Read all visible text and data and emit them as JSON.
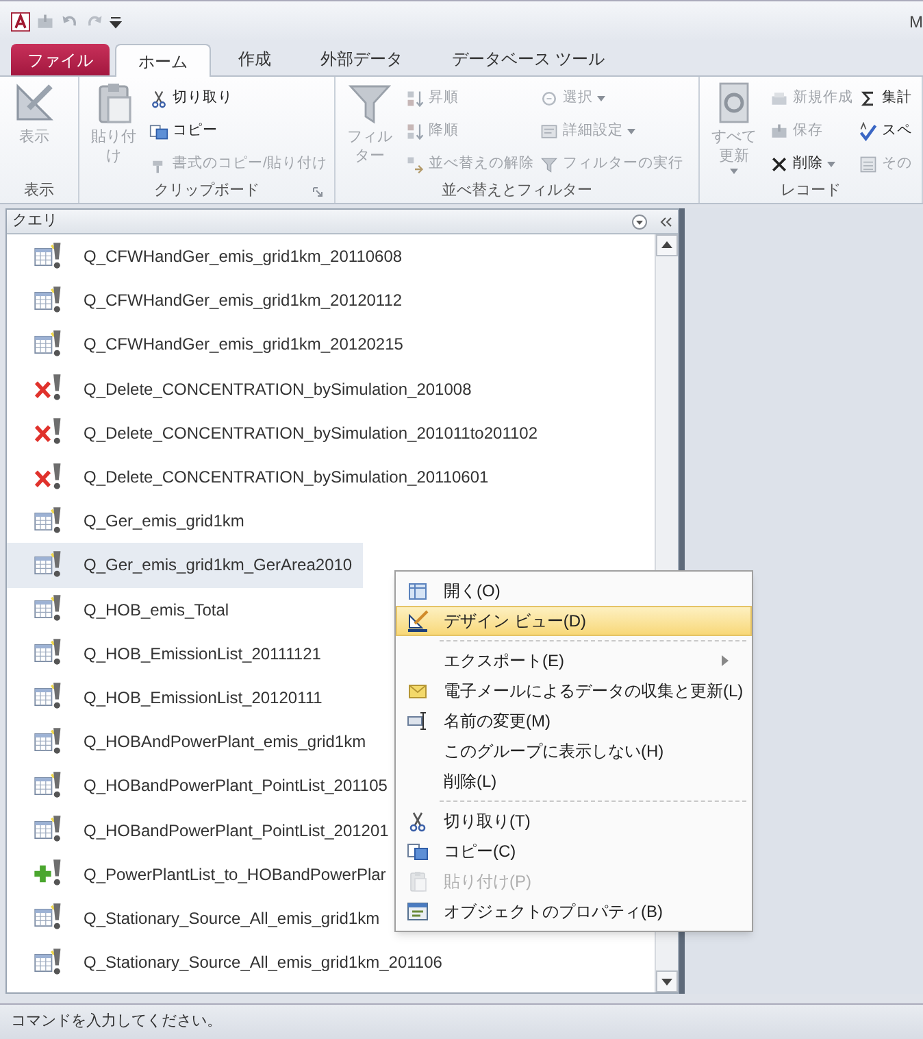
{
  "window": {
    "title": "M"
  },
  "tabs": [
    {
      "label": "ファイル",
      "kind": "file",
      "selected": false
    },
    {
      "label": "ホーム",
      "kind": "tab",
      "selected": true
    },
    {
      "label": "作成",
      "kind": "tab",
      "selected": false
    },
    {
      "label": "外部データ",
      "kind": "tab",
      "selected": false
    },
    {
      "label": "データベース ツール",
      "kind": "tab",
      "selected": false
    }
  ],
  "ribbon": {
    "groups": [
      {
        "label": "表示",
        "big": {
          "label": "表示",
          "disabled": true,
          "dropdown": false
        }
      },
      {
        "label": "クリップボード",
        "launcher": true,
        "big": {
          "label": "貼り付け",
          "disabled": true,
          "dropdown": false
        },
        "columns": [
          [
            {
              "label": "切り取り",
              "disabled": false,
              "dropdown": false
            },
            {
              "label": "コピー",
              "disabled": false,
              "dropdown": false
            },
            {
              "label": "書式のコピー/貼り付け",
              "disabled": true,
              "dropdown": false
            }
          ]
        ]
      },
      {
        "label": "並べ替えとフィルター",
        "big": {
          "label": "フィルター",
          "disabled": true,
          "dropdown": false
        },
        "columns": [
          [
            {
              "label": "昇順",
              "disabled": true,
              "dropdown": false
            },
            {
              "label": "降順",
              "disabled": true,
              "dropdown": false
            },
            {
              "label": "並べ替えの解除",
              "disabled": true,
              "dropdown": false
            }
          ],
          [
            {
              "label": "選択",
              "disabled": true,
              "dropdown": true
            },
            {
              "label": "詳細設定",
              "disabled": true,
              "dropdown": true
            },
            {
              "label": "フィルターの実行",
              "disabled": true,
              "dropdown": false
            }
          ]
        ]
      },
      {
        "label": "レコード",
        "big": {
          "label": "すべて更新",
          "disabled": true,
          "dropdown": true
        },
        "columns": [
          [
            {
              "label": "新規作成",
              "disabled": true,
              "dropdown": false
            },
            {
              "label": "保存",
              "disabled": true,
              "dropdown": false
            },
            {
              "label": "削除",
              "disabled": false,
              "dropdown": true
            }
          ],
          [
            {
              "label": "集計",
              "disabled": false,
              "dropdown": false
            },
            {
              "label": "スペ",
              "disabled": false,
              "dropdown": false
            },
            {
              "label": "その",
              "disabled": true,
              "dropdown": false
            }
          ]
        ]
      }
    ]
  },
  "navigation_pane": {
    "title": "クエリ",
    "items": [
      {
        "label": "Q_CFWHandGer_emis_grid1km_20110608",
        "kind": "select",
        "selected": false
      },
      {
        "label": "Q_CFWHandGer_emis_grid1km_20120112",
        "kind": "select",
        "selected": false
      },
      {
        "label": "Q_CFWHandGer_emis_grid1km_20120215",
        "kind": "select",
        "selected": false
      },
      {
        "label": "Q_Delete_CONCENTRATION_bySimulation_201008",
        "kind": "delete",
        "selected": false
      },
      {
        "label": "Q_Delete_CONCENTRATION_bySimulation_201011to201102",
        "kind": "delete",
        "selected": false
      },
      {
        "label": "Q_Delete_CONCENTRATION_bySimulation_20110601",
        "kind": "delete",
        "selected": false
      },
      {
        "label": "Q_Ger_emis_grid1km",
        "kind": "select",
        "selected": false
      },
      {
        "label": "Q_Ger_emis_grid1km_GerArea2010",
        "kind": "select",
        "selected": true
      },
      {
        "label": "Q_HOB_emis_Total",
        "kind": "select",
        "selected": false
      },
      {
        "label": "Q_HOB_EmissionList_20111121",
        "kind": "select",
        "selected": false
      },
      {
        "label": "Q_HOB_EmissionList_20120111",
        "kind": "select",
        "selected": false
      },
      {
        "label": "Q_HOBAndPowerPlant_emis_grid1km",
        "kind": "select",
        "selected": false
      },
      {
        "label": "Q_HOBandPowerPlant_PointList_201105",
        "kind": "select",
        "selected": false
      },
      {
        "label": "Q_HOBandPowerPlant_PointList_201201",
        "kind": "select",
        "selected": false
      },
      {
        "label": "Q_PowerPlantList_to_HOBandPowerPlar",
        "kind": "append",
        "selected": false
      },
      {
        "label": "Q_Stationary_Source_All_emis_grid1km",
        "kind": "select",
        "selected": false
      },
      {
        "label": "Q_Stationary_Source_All_emis_grid1km_201106",
        "kind": "select",
        "selected": false
      }
    ]
  },
  "context_menu": {
    "items": [
      {
        "kind": "item",
        "label": "開く(O)",
        "selected": false,
        "disabled": false
      },
      {
        "kind": "item",
        "label": "デザイン ビュー(D)",
        "selected": true,
        "disabled": false
      },
      {
        "kind": "separator"
      },
      {
        "kind": "item",
        "label": "エクスポート(E)",
        "selected": false,
        "disabled": false,
        "submenu": true
      },
      {
        "kind": "item",
        "label": "電子メールによるデータの収集と更新(L)",
        "selected": false,
        "disabled": false
      },
      {
        "kind": "item",
        "label": "名前の変更(M)",
        "selected": false,
        "disabled": false
      },
      {
        "kind": "item",
        "label": "このグループに表示しない(H)",
        "selected": false,
        "disabled": false
      },
      {
        "kind": "item",
        "label": "削除(L)",
        "selected": false,
        "disabled": false
      },
      {
        "kind": "separator"
      },
      {
        "kind": "item",
        "label": "切り取り(T)",
        "selected": false,
        "disabled": false
      },
      {
        "kind": "item",
        "label": "コピー(C)",
        "selected": false,
        "disabled": false
      },
      {
        "kind": "item",
        "label": "貼り付け(P)",
        "selected": false,
        "disabled": true
      },
      {
        "kind": "item",
        "label": "オブジェクトのプロパティ(B)",
        "selected": false,
        "disabled": false
      }
    ]
  },
  "status_bar": {
    "text": "コマンドを入力してください。"
  }
}
